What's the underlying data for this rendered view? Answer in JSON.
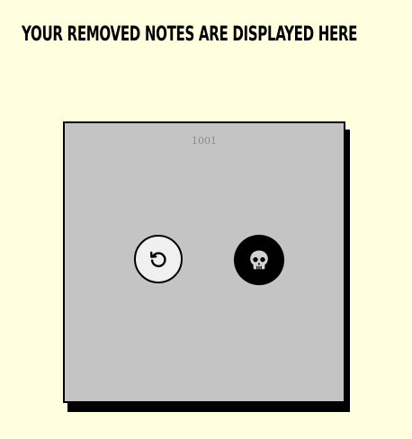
{
  "page": {
    "title": "Your removed notes are displayed here",
    "background_color": "#ffffe0"
  },
  "note": {
    "id": "1001",
    "card_color": "#c4c4c4",
    "restore_icon": "restore-icon",
    "delete_icon": "skull-icon"
  }
}
